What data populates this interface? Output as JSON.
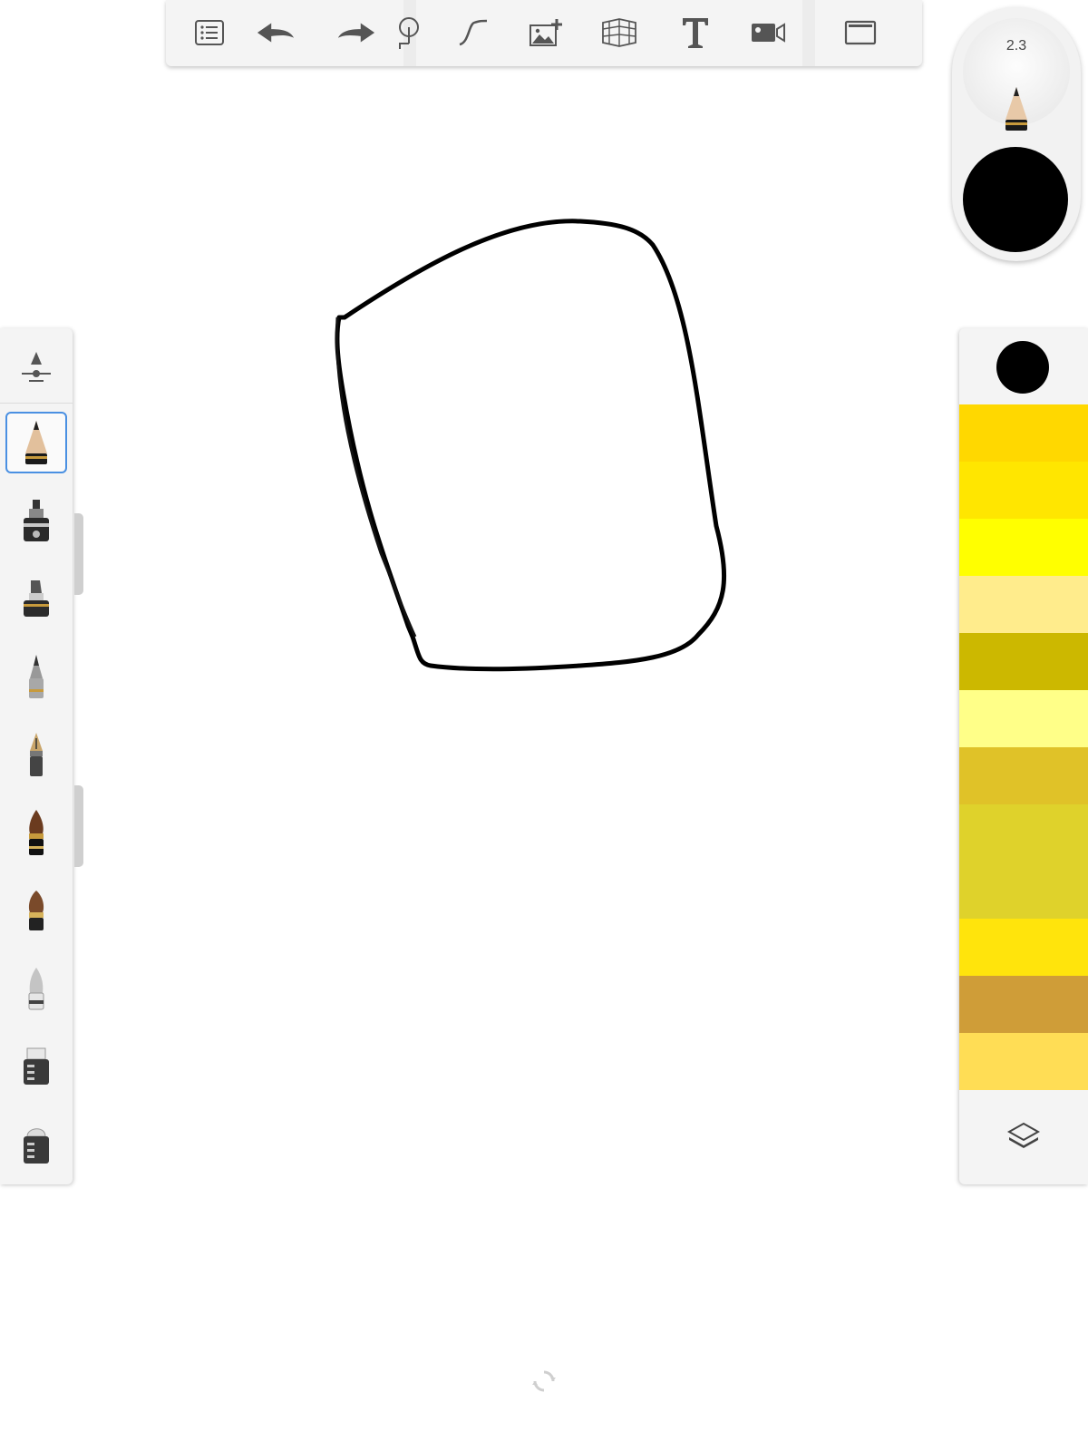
{
  "toolbar": {
    "buttons": [
      {
        "name": "menu-list-button",
        "icon": "list-icon"
      },
      {
        "name": "undo-button",
        "icon": "undo-arrow-icon"
      },
      {
        "name": "redo-button",
        "icon": "redo-arrow-icon"
      },
      {
        "name": "selection-tool-button",
        "icon": "lasso-icon"
      },
      {
        "name": "guides-button",
        "icon": "curve-icon"
      },
      {
        "name": "import-image-button",
        "icon": "image-add-icon"
      },
      {
        "name": "perspective-button",
        "icon": "perspective-grid-icon"
      },
      {
        "name": "text-button",
        "icon": "text-icon"
      },
      {
        "name": "record-button",
        "icon": "video-camera-icon"
      },
      {
        "name": "fullscreen-button",
        "icon": "frame-icon"
      }
    ]
  },
  "puck": {
    "brush_size": "2.3",
    "current_color": "#000000",
    "brush_icon": "pencil-icon"
  },
  "brushes": [
    {
      "name": "brush-settings",
      "icon": "slider-settings-icon"
    },
    {
      "name": "pencil",
      "icon": "pencil-icon",
      "selected": true
    },
    {
      "name": "marker",
      "icon": "marker-icon"
    },
    {
      "name": "chisel-marker",
      "icon": "chisel-marker-icon"
    },
    {
      "name": "ballpoint-pen",
      "icon": "ballpoint-pen-icon"
    },
    {
      "name": "fountain-pen",
      "icon": "fountain-pen-icon"
    },
    {
      "name": "ink-brush",
      "icon": "ink-brush-icon"
    },
    {
      "name": "paint-brush",
      "icon": "paint-brush-icon"
    },
    {
      "name": "airbrush",
      "icon": "airbrush-icon"
    },
    {
      "name": "eraser-hard",
      "icon": "eraser-icon"
    },
    {
      "name": "eraser-soft",
      "icon": "soft-eraser-icon"
    }
  ],
  "colors": {
    "current": "#000000",
    "swatches": [
      "#ffd800",
      "#ffe600",
      "#ffff00",
      "#ffec8c",
      "#ccb800",
      "#ffff88",
      "#e0c228",
      "#dfd22b",
      "#dfd22b",
      "#ffe40c",
      "#cf9d38",
      "#ffdd55"
    ]
  },
  "layers": {
    "icon": "layers-icon"
  },
  "status": {
    "icon": "sync-icon"
  },
  "drawing": {
    "stroke_color": "#000000"
  }
}
